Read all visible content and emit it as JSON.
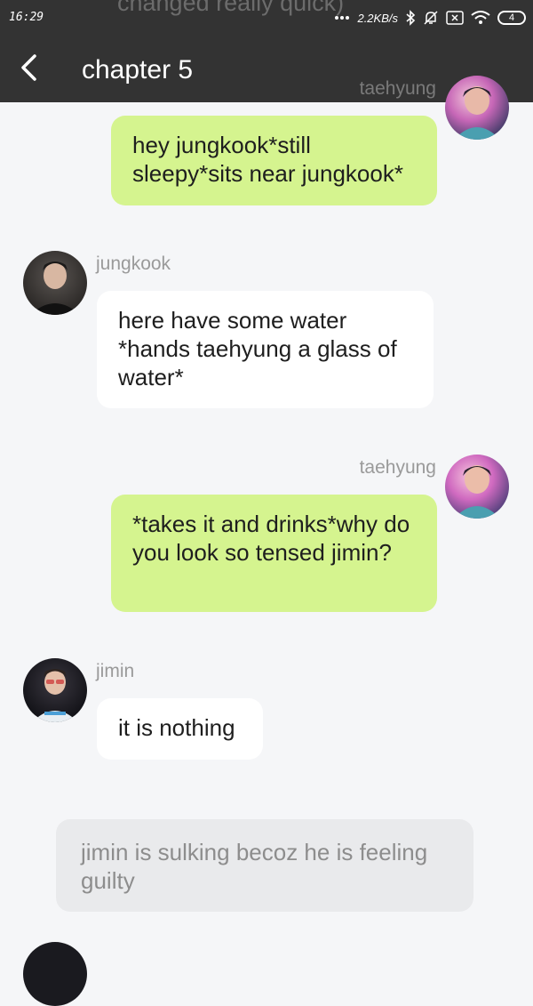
{
  "status_bar": {
    "time": "16:29",
    "network_speed": "2.2KB/s",
    "battery_level": "4"
  },
  "background_overlap_text": "changed really quick)",
  "header": {
    "back_icon": "chevron-left-icon",
    "title": "chapter 5"
  },
  "messages": [
    {
      "sender": "taehyung",
      "side": "right",
      "text": "hey jungkook*still sleepy*sits near jungkook*",
      "bubble_color": "#d5f48f"
    },
    {
      "sender": "jungkook",
      "side": "left",
      "text": "here have some water *hands taehyung a glass of water*",
      "bubble_color": "#ffffff"
    },
    {
      "sender": "taehyung",
      "side": "right",
      "text": "*takes it and drinks*why do you look so tensed jimin?",
      "bubble_color": "#d5f48f"
    },
    {
      "sender": "jimin",
      "side": "left",
      "text": "it is nothing",
      "bubble_color": "#ffffff"
    }
  ],
  "narration": "jimin is sulking becoz he is feeling guilty",
  "colors": {
    "header_bg": "#333333",
    "page_bg": "#f5f6f8",
    "green_bubble": "#d5f48f",
    "narration_bg": "#e9eaec",
    "name_text": "#9a9a9a"
  }
}
